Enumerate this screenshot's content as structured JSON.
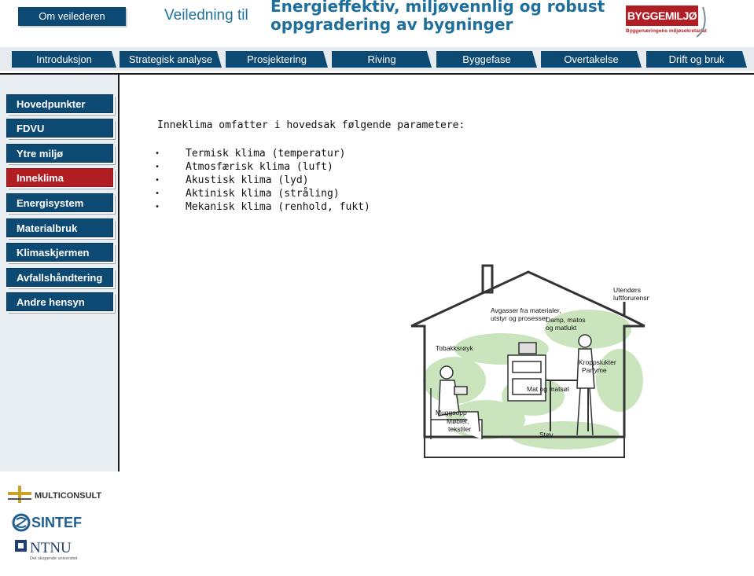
{
  "header": {
    "about_button": "Om veilederen",
    "guide_label": "Veiledning til",
    "title": "Energieffektiv, miljøvennlig og robust oppgradering av bygninger",
    "logo": {
      "name": "BYGGEMILJØ",
      "tagline": "Byggenæringens miljøsekretariat"
    }
  },
  "tabs": [
    {
      "label": "Introduksjon"
    },
    {
      "label": "Strategisk analyse"
    },
    {
      "label": "Prosjektering"
    },
    {
      "label": "Riving"
    },
    {
      "label": "Byggefase"
    },
    {
      "label": "Overtakelse"
    },
    {
      "label": "Drift og bruk"
    }
  ],
  "sidebar": {
    "items": [
      {
        "label": "Hovedpunkter"
      },
      {
        "label": "FDVU"
      },
      {
        "label": "Ytre miljø"
      },
      {
        "label": "Inneklima",
        "active": true
      },
      {
        "label": "Energisystem"
      },
      {
        "label": "Materialbruk"
      },
      {
        "label": "Klimaskjermen"
      },
      {
        "label": "Avfallshåndtering"
      },
      {
        "label": "Andre hensyn"
      }
    ]
  },
  "content": {
    "intro": "Inneklima omfatter i hovedsak følgende parametere:",
    "parameters": [
      "Termisk klima (temperatur)",
      "Atmosfærisk klima (luft)",
      "Akustisk klima (lyd)",
      "Aktinisk klima (stråling)",
      "Mekanisk klima (renhold, fukt)"
    ]
  },
  "illustration": {
    "labels": {
      "outdoor": "Utendørs",
      "outdoor2": "luftforurensning",
      "emissions": "Avgasser fra materialer,",
      "emissions2": "utstyr og prosesser",
      "tobacco": "Tobakksrøyk",
      "steam": "Damp, matos",
      "steam2": "og matlukt",
      "body": "Kroppslukter",
      "perfume": "Parfyme",
      "food": "Mat og matsøl",
      "mould": "Muggsopp",
      "furniture": "Møbler,",
      "textiles": "tekstiler",
      "dust": "Støv"
    }
  },
  "partners": {
    "multiconsult": "MULTICONSULT",
    "sintef": "SINTEF",
    "ntnu": "NTNU",
    "ntnu_tagline": "Det skapende universitet"
  },
  "colors": {
    "nav_blue": "#0d4a73",
    "active_red": "#b01e23",
    "title_blue": "#1f6f9c"
  }
}
